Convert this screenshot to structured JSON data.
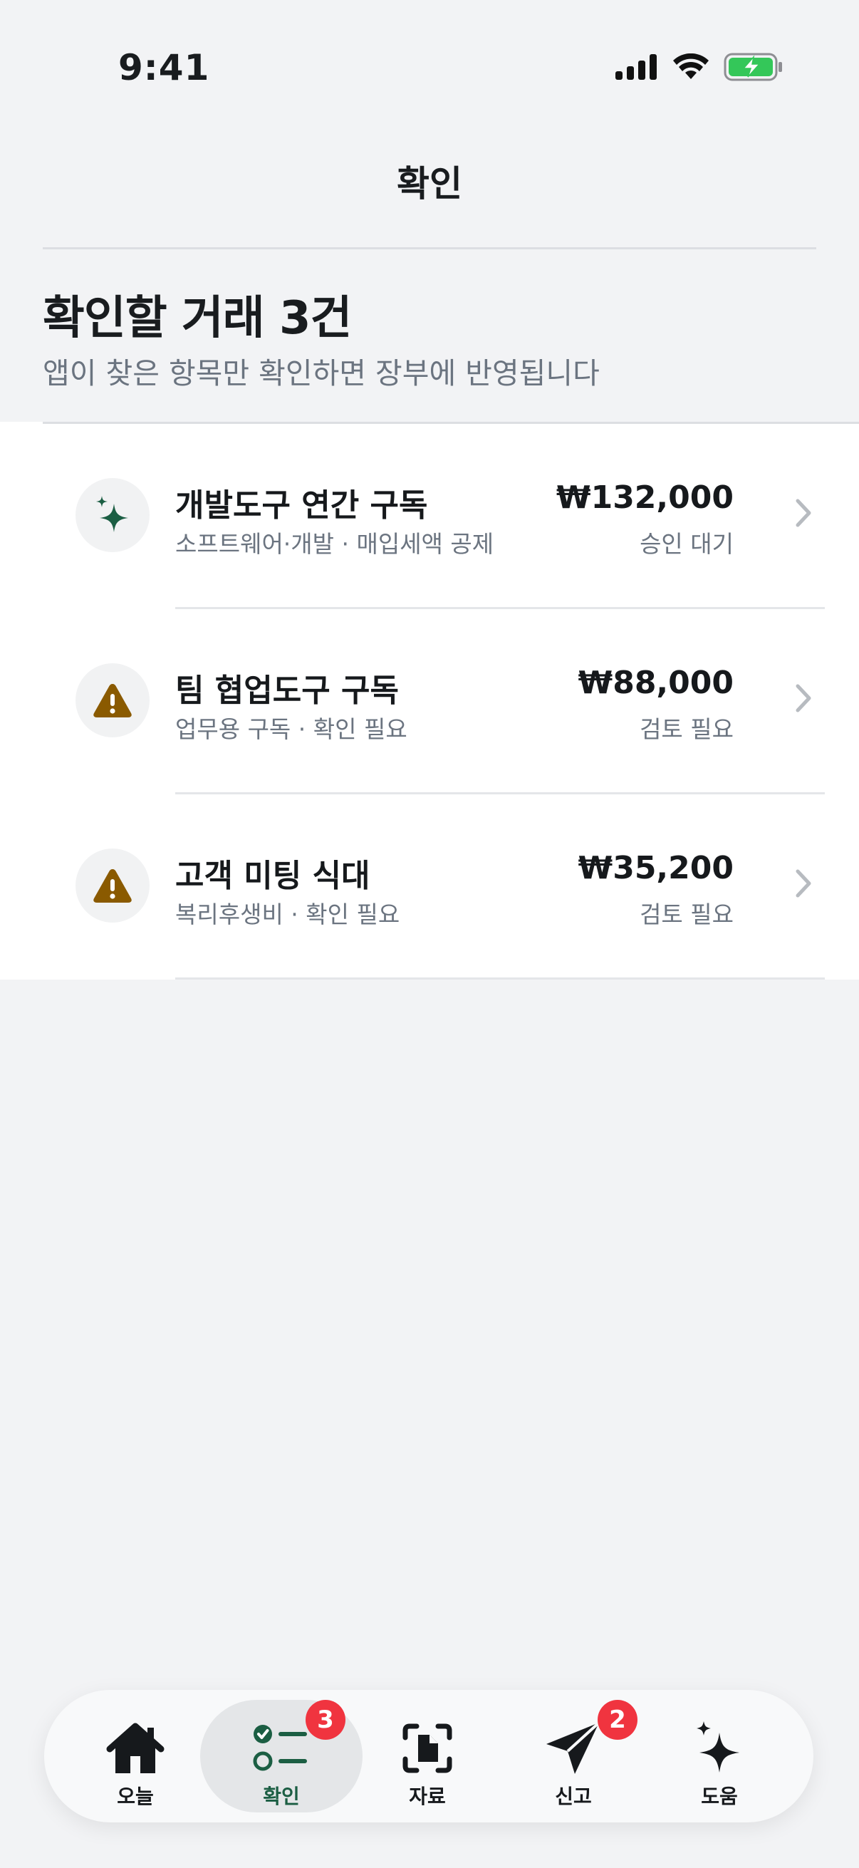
{
  "status_bar": {
    "time": "9:41"
  },
  "nav": {
    "title": "확인"
  },
  "header": {
    "title": "확인할 거래 3건",
    "subtitle": "앱이 찾은 항목만 확인하면 장부에 반영됩니다"
  },
  "items": [
    {
      "icon": "sparkle-icon",
      "title": "개발도구 연간 구독",
      "subtitle": "소프트웨어·개발 · 매입세액 공제",
      "amount": "₩132,000",
      "status": "승인 대기"
    },
    {
      "icon": "warning-icon",
      "title": "팀 협업도구 구독",
      "subtitle": "업무용 구독 · 확인 필요",
      "amount": "₩88,000",
      "status": "검토 필요"
    },
    {
      "icon": "warning-icon",
      "title": "고객 미팅 식대",
      "subtitle": "복리후생비 · 확인 필요",
      "amount": "₩35,200",
      "status": "검토 필요"
    }
  ],
  "tabs": [
    {
      "label": "오늘",
      "icon": "home-icon"
    },
    {
      "label": "확인",
      "icon": "checklist-icon",
      "badge": "3",
      "active": true
    },
    {
      "label": "자료",
      "icon": "document-scan-icon"
    },
    {
      "label": "신고",
      "icon": "send-icon",
      "badge": "2"
    },
    {
      "label": "도움",
      "icon": "sparkles-icon"
    }
  ],
  "colors": {
    "accent_green": "#1b5e43",
    "warning_brown": "#8a5a00",
    "badge_red": "#f0343f",
    "battery_green": "#34c759"
  }
}
